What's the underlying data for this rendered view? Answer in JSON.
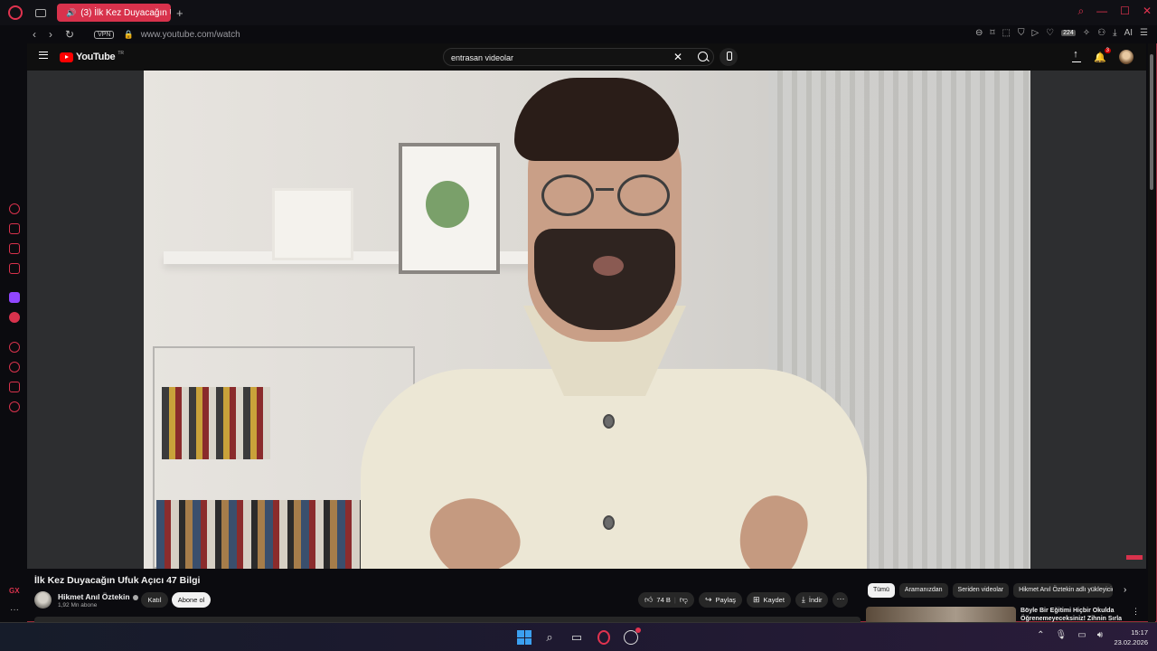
{
  "browser": {
    "tab_title": "(3) İlk Kez Duyacağın U",
    "url": "www.youtube.com/watch",
    "vpn_label": "VPN",
    "ext_badge": "224",
    "ai_label": "AI"
  },
  "youtube": {
    "logo_text": "YouTube",
    "region": "TR",
    "search_value": "entrasan videolar",
    "notification_count": "3"
  },
  "video": {
    "title": "İlk Kez Duyacağın Ufuk Açıcı 47 Bilgi",
    "channel_name": "Hikmet Anıl Öztekin",
    "subscribers": "1,92 Mn abone",
    "join_label": "Katıl",
    "subscribe_label": "Abone ol",
    "like_count": "74 B",
    "share_label": "Paylaş",
    "save_label": "Kaydet",
    "download_label": "İndir"
  },
  "chips": [
    "Tümü",
    "Aramanızdan",
    "Seriden videolar",
    "Hikmet Anıl Öztekin adlı yükleyicid"
  ],
  "recommendation": {
    "title_line1": "Böyle Bir Eğitimi Hiçbir Okulda",
    "title_line2": "Öğrenemeyeceksiniz! Zihnin Sırlarını..."
  },
  "sidebar": {
    "gx_label": "GX"
  },
  "taskbar": {
    "time": "15:17",
    "date": "23.02.2026"
  },
  "colors": {
    "accent": "#d8324c",
    "youtube_red": "#ff0000",
    "background": "#0f0f0f"
  }
}
